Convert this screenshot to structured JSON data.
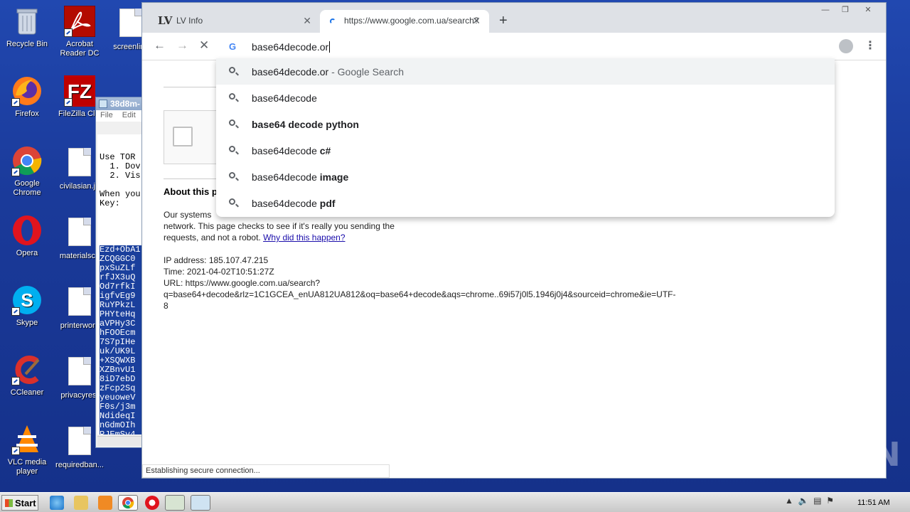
{
  "desktop": {
    "icons": [
      {
        "label": "Recycle Bin"
      },
      {
        "label": "Acrobat Reader DC"
      },
      {
        "label": "screenlimi"
      },
      {
        "label": "Firefox"
      },
      {
        "label": "FileZilla Clie"
      },
      {
        "label": "Google Chrome"
      },
      {
        "label": "civilasian.jp"
      },
      {
        "label": "Opera"
      },
      {
        "label": "materialsco"
      },
      {
        "label": "Skype"
      },
      {
        "label": "printerwork"
      },
      {
        "label": "CCleaner"
      },
      {
        "label": "privacyrest"
      },
      {
        "label": "VLC media player"
      },
      {
        "label": "requiredban..."
      }
    ]
  },
  "notepad": {
    "title": "38d8m-",
    "menu": [
      "File",
      "Edit"
    ],
    "lines_plain": [
      "Use TOR",
      "  1. Dov",
      "  2. Vis",
      "",
      "When you",
      "Key:",
      "",
      ""
    ],
    "lines_selected": [
      "Ezd+ObA1",
      "ZCQGGC0",
      "pxSuZLf",
      "rfJX3uQ",
      "Od7rfkI",
      "igfvEg9",
      "RuYPkzL",
      "PHYteHq",
      "aVPHy3C",
      "hFOOEcm",
      "7S7pIHe",
      "uk/UK9L",
      "+XSQWXB",
      "XZBnvU1",
      "8iD7ebD",
      "zFcp2Sq",
      "yeuoweV",
      "F0s/j3m",
      "NdideqI",
      "nGdmOIh",
      "PJEmSv4"
    ]
  },
  "browser": {
    "tabs": [
      {
        "label": "LV Info"
      },
      {
        "label": "https://www.google.com.ua/search?"
      }
    ],
    "omnibox_value": "base64decode.or",
    "suggestions": [
      {
        "text": "base64decode.or",
        "suffix": " - Google Search",
        "bold": ""
      },
      {
        "text": "base64decode",
        "suffix": "",
        "bold": ""
      },
      {
        "text": "",
        "suffix": "",
        "bold": "base64 decode python"
      },
      {
        "text": "base64decode ",
        "suffix": "",
        "bold": "c#"
      },
      {
        "text": "base64decode ",
        "suffix": "",
        "bold": "image"
      },
      {
        "text": "base64decode ",
        "suffix": "",
        "bold": "pdf"
      }
    ],
    "page": {
      "about_heading": "About this p",
      "para1_line1": "Our systems",
      "para1_line1_tail": "network. This page checks to see if it's really you sending the",
      "para1_line2": "requests, and not a robot.",
      "why_link": "Why did this happen?",
      "ip_line": "IP address: 185.107.47.215",
      "time_line": "Time: 2021-04-02T10:51:27Z",
      "url_line1": "URL: https://www.google.com.ua/search?",
      "url_line2": "q=base64+decode&rlz=1C1GCEA_enUA812UA812&oq=base64+decode&aqs=chrome..69i57j0l5.1946j0j4&sourceid=chrome&ie=UTF-",
      "url_line3": "8"
    },
    "status": "Establishing secure connection..."
  },
  "watermark": "ANY RUN",
  "taskbar": {
    "start_label": "Start",
    "clock": "11:51 AM"
  }
}
